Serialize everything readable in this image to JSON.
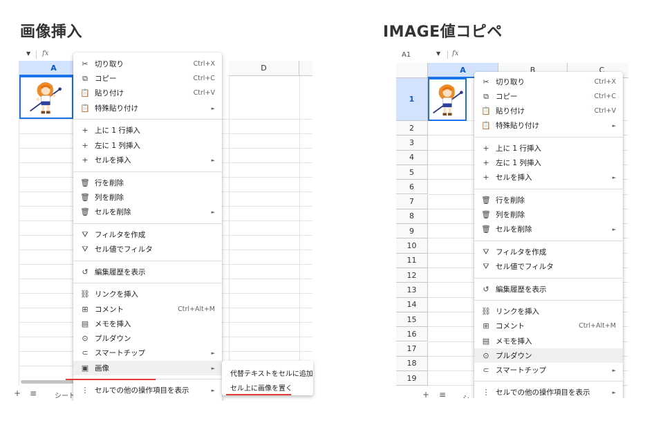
{
  "left": {
    "heading": "画像挿入",
    "fx": "fx",
    "col_a": "A",
    "col_d": "D",
    "sheet_tab": "シート",
    "add_sheet": "+",
    "sheet_list": "≡",
    "menu": {
      "cut": {
        "label": "切り取り",
        "shortcut": "Ctrl+X"
      },
      "copy": {
        "label": "コピー",
        "shortcut": "Ctrl+C"
      },
      "paste": {
        "label": "貼り付け",
        "shortcut": "Ctrl+V"
      },
      "paste_special": {
        "label": "特殊貼り付け"
      },
      "insert_row_above": {
        "label": "上に 1 行挿入"
      },
      "insert_col_left": {
        "label": "左に 1 列挿入"
      },
      "insert_cells": {
        "label": "セルを挿入"
      },
      "delete_row": {
        "label": "行を削除"
      },
      "delete_col": {
        "label": "列を削除"
      },
      "delete_cells": {
        "label": "セルを削除"
      },
      "create_filter": {
        "label": "フィルタを作成"
      },
      "filter_by_value": {
        "label": "セル値でフィルタ"
      },
      "edit_history": {
        "label": "編集履歴を表示"
      },
      "insert_link": {
        "label": "リンクを挿入"
      },
      "comment": {
        "label": "コメント",
        "shortcut": "Ctrl+Alt+M"
      },
      "insert_note": {
        "label": "メモを挿入"
      },
      "dropdown": {
        "label": "プルダウン"
      },
      "smart_chips": {
        "label": "スマートチップ"
      },
      "image": {
        "label": "画像"
      },
      "more_actions": {
        "label": "セルでの他の操作項目を表示"
      }
    },
    "submenu": {
      "alt_text": "代替テキストをセルに追加",
      "place_over_cells": "セル上に画像を置く"
    }
  },
  "right": {
    "heading": "IMAGE値コピペ",
    "cell_ref": "A1",
    "fx": "fx",
    "cols": [
      "A",
      "B",
      "C"
    ],
    "rows": [
      "1",
      "2",
      "3",
      "4",
      "5",
      "6",
      "7",
      "8",
      "9",
      "10",
      "11",
      "12",
      "13",
      "14",
      "15",
      "16",
      "17",
      "18",
      "19"
    ],
    "sheet_tab": "シ",
    "add_sheet": "+",
    "sheet_list": "≡",
    "menu": {
      "cut": {
        "label": "切り取り",
        "shortcut": "Ctrl+X"
      },
      "copy": {
        "label": "コピー",
        "shortcut": "Ctrl+C"
      },
      "paste": {
        "label": "貼り付け",
        "shortcut": "Ctrl+V"
      },
      "paste_special": {
        "label": "特殊貼り付け"
      },
      "insert_row_above": {
        "label": "上に 1 行挿入"
      },
      "insert_col_left": {
        "label": "左に 1 列挿入"
      },
      "insert_cells": {
        "label": "セルを挿入"
      },
      "delete_row": {
        "label": "行を削除"
      },
      "delete_col": {
        "label": "列を削除"
      },
      "delete_cells": {
        "label": "セルを削除"
      },
      "create_filter": {
        "label": "フィルタを作成"
      },
      "filter_by_value": {
        "label": "セル値でフィルタ"
      },
      "edit_history": {
        "label": "編集履歴を表示"
      },
      "insert_link": {
        "label": "リンクを挿入"
      },
      "comment": {
        "label": "コメント",
        "shortcut": "Ctrl+Alt+M"
      },
      "insert_note": {
        "label": "メモを挿入"
      },
      "dropdown": {
        "label": "プルダウン"
      },
      "smart_chips": {
        "label": "スマートチップ"
      },
      "more_actions": {
        "label": "セルでの他の操作項目を表示"
      }
    }
  },
  "colors": {
    "selected_header": "#d3e3fd",
    "selection_border": "#1a73e8",
    "annotation_red": "#e53935"
  },
  "icons": {
    "cut": "scissors-icon",
    "copy": "copy-icon",
    "paste": "clipboard-icon",
    "insert": "plus-icon",
    "delete": "trash-icon",
    "filter": "filter-icon",
    "history": "history-icon",
    "link": "link-icon",
    "comment": "comment-plus-icon",
    "note": "note-icon",
    "dropdown": "dropdown-circle-icon",
    "smart_chips": "chip-icon",
    "image": "image-icon",
    "more": "more-vertical-icon"
  }
}
